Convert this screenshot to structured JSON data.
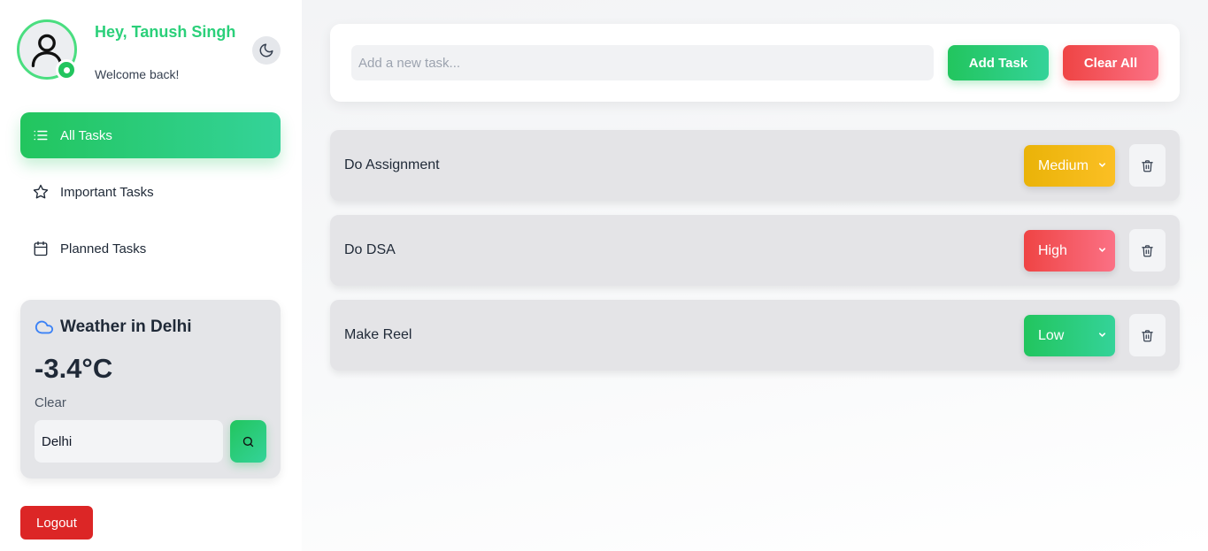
{
  "profile": {
    "greeting": "Hey, Tanush Singh",
    "welcome": "Welcome back!"
  },
  "nav": {
    "items": [
      {
        "label": "All Tasks",
        "icon": "list-icon",
        "active": true
      },
      {
        "label": "Important Tasks",
        "icon": "star-icon",
        "active": false
      },
      {
        "label": "Planned Tasks",
        "icon": "calendar-icon",
        "active": false
      }
    ]
  },
  "weather": {
    "title": "Weather in Delhi",
    "temperature": "-3.4°C",
    "condition": "Clear",
    "city_value": "Delhi"
  },
  "logout_label": "Logout",
  "add_task": {
    "placeholder": "Add a new task...",
    "add_label": "Add Task",
    "clear_label": "Clear All"
  },
  "tasks": [
    {
      "text": "Do Assignment",
      "priority": "Medium"
    },
    {
      "text": "Do DSA",
      "priority": "High"
    },
    {
      "text": "Make Reel",
      "priority": "Low"
    }
  ],
  "colors": {
    "accent_green": "#22c55e",
    "danger_red": "#ef4444",
    "medium_yellow": "#eab308",
    "logout_red": "#dc2626"
  }
}
